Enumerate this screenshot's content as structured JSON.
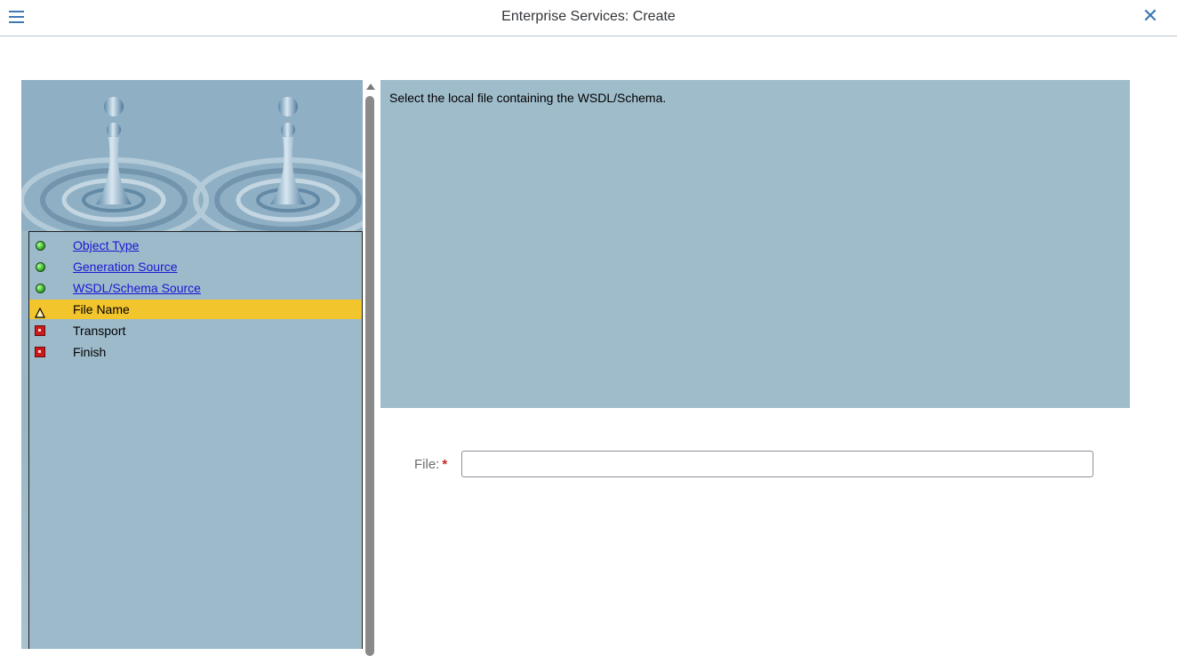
{
  "window": {
    "title": "Enterprise Services: Create",
    "menu_icon": "hamburger-menu-icon",
    "close_icon": "close-icon"
  },
  "nav": {
    "items": [
      {
        "label": "Object Type",
        "status": "complete",
        "link": true
      },
      {
        "label": "Generation Source",
        "status": "complete",
        "link": true
      },
      {
        "label": "WSDL/Schema Source",
        "status": "complete",
        "link": true
      },
      {
        "label": "File Name",
        "status": "current",
        "link": false
      },
      {
        "label": "Transport",
        "status": "pending",
        "link": false
      },
      {
        "label": "Finish",
        "status": "pending",
        "link": false
      }
    ]
  },
  "content": {
    "instruction": "Select the local file containing the WSDL/Schema.",
    "file_label": "File:",
    "required_mark": "*",
    "file_value": ""
  },
  "colors": {
    "accent": "#3d7ab4",
    "panel": "#9fbccb",
    "active_step": "#f3c52d",
    "link": "#1d16d2",
    "required": "#c0291d"
  }
}
